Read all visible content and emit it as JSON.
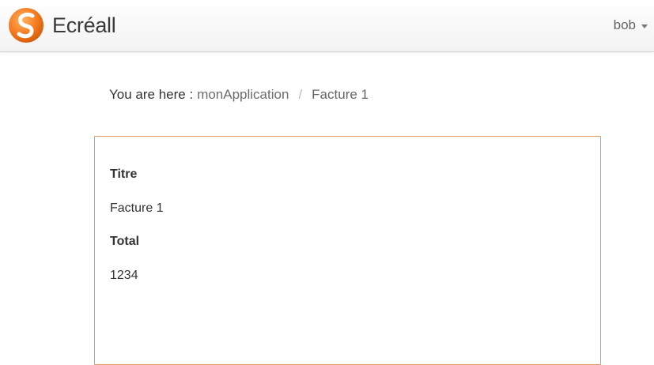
{
  "navbar": {
    "brand": "Ecréall",
    "logo_icon": "orange-s-logo-icon",
    "user": "bob",
    "caret_icon": "caret-down-icon"
  },
  "breadcrumb": {
    "prefix": "You are here :",
    "items": [
      "monApplication",
      "Facture 1"
    ],
    "divider": "/"
  },
  "record": {
    "fields": [
      {
        "label": "Titre",
        "value": "Facture 1"
      },
      {
        "label": "Total",
        "value": "1234"
      }
    ]
  },
  "colors": {
    "accent": "#f47a20",
    "panel_border": "#e39a5c"
  }
}
